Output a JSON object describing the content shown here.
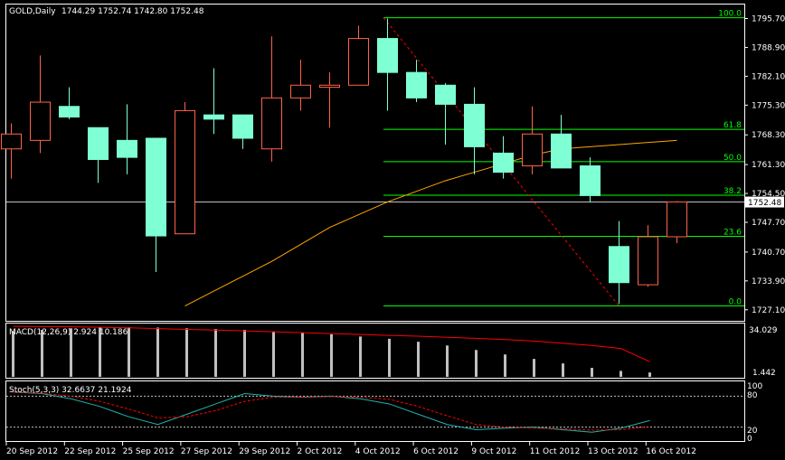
{
  "header": {
    "symbol_label": "GOLD,Daily",
    "ohlc": "1744.29 1752.74 1742.80 1752.48"
  },
  "colors": {
    "background": "#000000",
    "frame": "#ffffff",
    "bull_fill": "#7fffd4",
    "bear_outline": "#ff6347",
    "fib": "#00ff00",
    "ma": "#ffa500",
    "trend": "#ff0000",
    "macd_hist": "#c0c0c0",
    "macd_signal": "#ff0000",
    "stoch_main": "#20b2aa",
    "stoch_signal": "#ff0000",
    "level": "#c0c0c0"
  },
  "price_axis": {
    "ticks": [
      "1795.70",
      "1788.90",
      "1782.10",
      "1775.30",
      "1768.30",
      "1761.30",
      "1754.50",
      "1747.70",
      "1740.70",
      "1733.90",
      "1727.10"
    ],
    "current_price": "1752.48"
  },
  "fib_levels": [
    {
      "label": "100.0",
      "price": 1795.9
    },
    {
      "label": "61.8",
      "price": 1769.6
    },
    {
      "label": "50.0",
      "price": 1762.0
    },
    {
      "label": "38.2",
      "price": 1754.1
    },
    {
      "label": "23.6",
      "price": 1744.4
    },
    {
      "label": "0.0",
      "price": 1728.0
    }
  ],
  "x_axis": {
    "labels": [
      "20 Sep 2012",
      "22 Sep 2012",
      "25 Sep 2012",
      "27 Sep 2012",
      "29 Sep 2012",
      "2 Oct 2012",
      "4 Oct 2012",
      "6 Oct 2012",
      "9 Oct 2012",
      "11 Oct 2012",
      "13 Oct 2012",
      "16 Oct 2012"
    ]
  },
  "macd": {
    "label": "MACD(12,26,9) 2.924 10.186",
    "scale_top": "34.029",
    "scale_bottom": "1.442",
    "histogram": [
      30.5,
      31.5,
      32.5,
      33.0,
      33.2,
      33.0,
      32.5,
      32.0,
      31.5,
      30.5,
      29.5,
      28.5,
      27.0,
      25.5,
      23.5,
      21.0,
      18.0,
      15.0,
      12.0,
      9.0,
      6.0,
      4.0,
      2.924
    ],
    "signal": [
      33.8,
      33.7,
      33.5,
      33.2,
      32.8,
      32.3,
      31.8,
      31.3,
      30.8,
      30.2,
      29.6,
      29.0,
      28.4,
      27.8,
      27.2,
      26.5,
      25.8,
      25.0,
      24.0,
      22.5,
      21.0,
      19.0,
      10.186
    ]
  },
  "stoch": {
    "label": "Stoch(5,3,3) 32.6637 21.1924",
    "scale": [
      "100",
      "80",
      "20",
      "0"
    ],
    "main": [
      88,
      85,
      75,
      60,
      40,
      25,
      45,
      65,
      85,
      80,
      78,
      80,
      75,
      65,
      45,
      25,
      15,
      18,
      20,
      15,
      10,
      18,
      32.6637
    ],
    "signal": [
      88,
      86,
      80,
      70,
      55,
      38,
      40,
      52,
      70,
      78,
      78,
      79,
      78,
      74,
      60,
      42,
      25,
      20,
      18,
      17,
      14,
      15,
      21.1924
    ]
  },
  "candles": [
    {
      "o": 1765.0,
      "h": 1771.0,
      "l": 1758.0,
      "c": 1768.5
    },
    {
      "o": 1767.0,
      "h": 1787.0,
      "l": 1764.0,
      "c": 1776.0
    },
    {
      "o": 1775.0,
      "h": 1779.5,
      "l": 1772.0,
      "c": 1772.5
    },
    {
      "o": 1770.0,
      "h": 1770.0,
      "l": 1757.0,
      "c": 1762.5
    },
    {
      "o": 1767.0,
      "h": 1775.5,
      "l": 1759.0,
      "c": 1763.0
    },
    {
      "o": 1767.5,
      "h": 1767.5,
      "l": 1736.0,
      "c": 1744.5
    },
    {
      "o": 1745.0,
      "h": 1776.0,
      "l": 1745.0,
      "c": 1774.0
    },
    {
      "o": 1773.0,
      "h": 1784.0,
      "l": 1768.5,
      "c": 1772.0
    },
    {
      "o": 1773.0,
      "h": 1773.0,
      "l": 1765.0,
      "c": 1767.5
    },
    {
      "o": 1765.0,
      "h": 1791.5,
      "l": 1762.0,
      "c": 1777.0
    },
    {
      "o": 1777.0,
      "h": 1786.0,
      "l": 1774.0,
      "c": 1780.0
    },
    {
      "o": 1779.5,
      "h": 1783.0,
      "l": 1770.0,
      "c": 1780.0
    },
    {
      "o": 1780.0,
      "h": 1794.0,
      "l": 1780.0,
      "c": 1791.0
    },
    {
      "o": 1791.0,
      "h": 1795.7,
      "l": 1774.0,
      "c": 1783.0
    },
    {
      "o": 1783.0,
      "h": 1786.0,
      "l": 1776.0,
      "c": 1777.0
    },
    {
      "o": 1780.0,
      "h": 1780.5,
      "l": 1766.0,
      "c": 1775.5
    },
    {
      "o": 1775.5,
      "h": 1779.5,
      "l": 1759.0,
      "c": 1765.5
    },
    {
      "o": 1764.0,
      "h": 1768.0,
      "l": 1758.0,
      "c": 1759.5
    },
    {
      "o": 1761.0,
      "h": 1775.0,
      "l": 1759.0,
      "c": 1768.5
    },
    {
      "o": 1768.5,
      "h": 1773.0,
      "l": 1761.0,
      "c": 1760.5
    },
    {
      "o": 1761.0,
      "h": 1763.0,
      "l": 1752.5,
      "c": 1754.0
    },
    {
      "o": 1742.0,
      "h": 1748.0,
      "l": 1728.5,
      "c": 1733.5
    },
    {
      "o": 1733.0,
      "h": 1747.0,
      "l": 1732.5,
      "c": 1744.3
    },
    {
      "o": 1744.3,
      "h": 1752.7,
      "l": 1742.8,
      "c": 1752.5
    }
  ],
  "ma": [
    null,
    null,
    null,
    null,
    null,
    null,
    1728.0,
    1731.5,
    1735.0,
    1738.5,
    1742.5,
    1746.5,
    1749.5,
    1752.5,
    1755.0,
    1757.5,
    1759.5,
    1761.5,
    1763.5,
    1765.0,
    1765.5,
    1766.0,
    1766.5,
    1767.0
  ]
}
